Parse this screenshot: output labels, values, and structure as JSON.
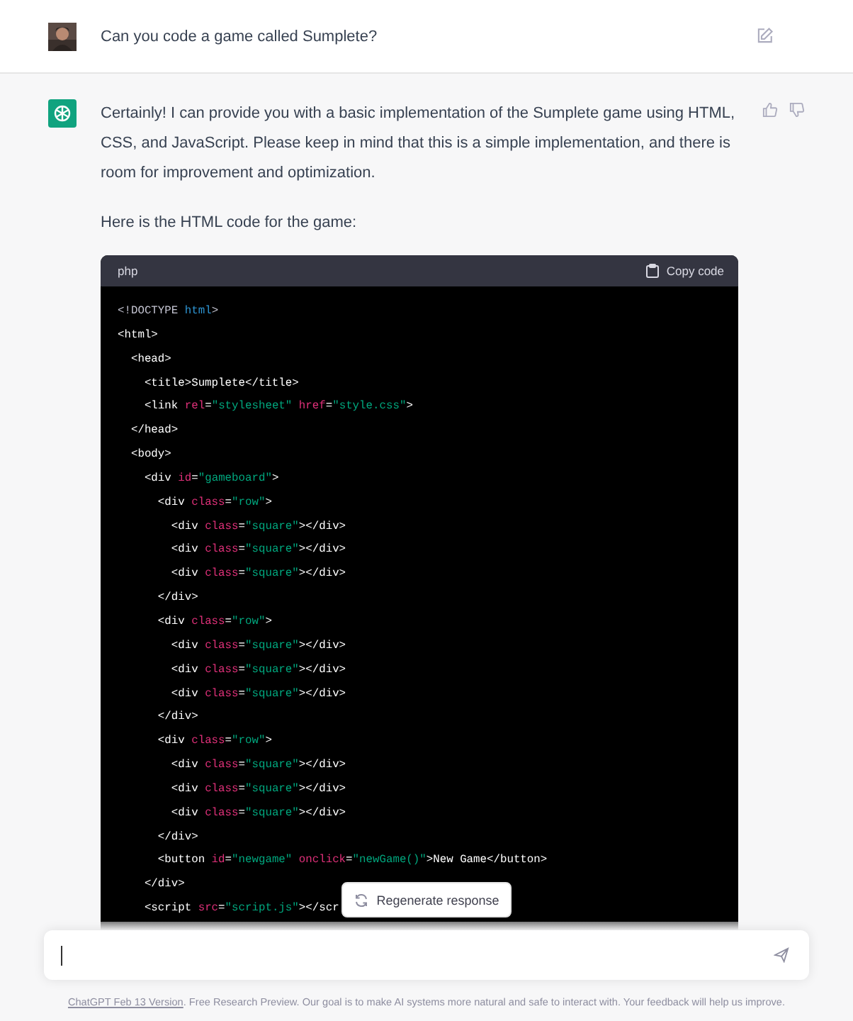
{
  "user_message": {
    "text": "Can you code a game called Sumplete?"
  },
  "assistant_message": {
    "paragraphs": [
      "Certainly! I can provide you with a basic implementation of the Sumplete game using HTML, CSS, and JavaScript. Please keep in mind that this is a simple implementation, and there is room for improvement and optimization.",
      "Here is the HTML code for the game:"
    ],
    "code_block": {
      "language": "php",
      "copy_label": "Copy code",
      "lines": [
        [
          {
            "kind": "punct",
            "text": "<!DOCTYPE "
          },
          {
            "kind": "keyword",
            "text": "html"
          },
          {
            "kind": "punct",
            "text": ">"
          }
        ],
        [
          {
            "kind": "tag",
            "text": "<html>"
          }
        ],
        [
          {
            "kind": "tag",
            "text": "  <head>"
          }
        ],
        [
          {
            "kind": "tag",
            "text": "    <title>Sumplete</title>"
          }
        ],
        [
          {
            "kind": "tag",
            "text": "    <link "
          },
          {
            "kind": "attr",
            "text": "rel"
          },
          {
            "kind": "tag",
            "text": "="
          },
          {
            "kind": "str",
            "text": "\"stylesheet\" "
          },
          {
            "kind": "attr",
            "text": "href"
          },
          {
            "kind": "tag",
            "text": "="
          },
          {
            "kind": "str",
            "text": "\"style.css\""
          },
          {
            "kind": "tag",
            "text": ">"
          }
        ],
        [
          {
            "kind": "tag",
            "text": "  </head>"
          }
        ],
        [
          {
            "kind": "tag",
            "text": "  <body>"
          }
        ],
        [
          {
            "kind": "tag",
            "text": "    <div "
          },
          {
            "kind": "attr",
            "text": "id"
          },
          {
            "kind": "tag",
            "text": "="
          },
          {
            "kind": "str",
            "text": "\"gameboard\""
          },
          {
            "kind": "tag",
            "text": ">"
          }
        ],
        [
          {
            "kind": "tag",
            "text": "      <div "
          },
          {
            "kind": "attr",
            "text": "class"
          },
          {
            "kind": "tag",
            "text": "="
          },
          {
            "kind": "str",
            "text": "\"row\""
          },
          {
            "kind": "tag",
            "text": ">"
          }
        ],
        [
          {
            "kind": "tag",
            "text": "        <div "
          },
          {
            "kind": "attr",
            "text": "class"
          },
          {
            "kind": "tag",
            "text": "="
          },
          {
            "kind": "str",
            "text": "\"square\""
          },
          {
            "kind": "tag",
            "text": "></div>"
          }
        ],
        [
          {
            "kind": "tag",
            "text": "        <div "
          },
          {
            "kind": "attr",
            "text": "class"
          },
          {
            "kind": "tag",
            "text": "="
          },
          {
            "kind": "str",
            "text": "\"square\""
          },
          {
            "kind": "tag",
            "text": "></div>"
          }
        ],
        [
          {
            "kind": "tag",
            "text": "        <div "
          },
          {
            "kind": "attr",
            "text": "class"
          },
          {
            "kind": "tag",
            "text": "="
          },
          {
            "kind": "str",
            "text": "\"square\""
          },
          {
            "kind": "tag",
            "text": "></div>"
          }
        ],
        [
          {
            "kind": "tag",
            "text": "      </div>"
          }
        ],
        [
          {
            "kind": "tag",
            "text": "      <div "
          },
          {
            "kind": "attr",
            "text": "class"
          },
          {
            "kind": "tag",
            "text": "="
          },
          {
            "kind": "str",
            "text": "\"row\""
          },
          {
            "kind": "tag",
            "text": ">"
          }
        ],
        [
          {
            "kind": "tag",
            "text": "        <div "
          },
          {
            "kind": "attr",
            "text": "class"
          },
          {
            "kind": "tag",
            "text": "="
          },
          {
            "kind": "str",
            "text": "\"square\""
          },
          {
            "kind": "tag",
            "text": "></div>"
          }
        ],
        [
          {
            "kind": "tag",
            "text": "        <div "
          },
          {
            "kind": "attr",
            "text": "class"
          },
          {
            "kind": "tag",
            "text": "="
          },
          {
            "kind": "str",
            "text": "\"square\""
          },
          {
            "kind": "tag",
            "text": "></div>"
          }
        ],
        [
          {
            "kind": "tag",
            "text": "        <div "
          },
          {
            "kind": "attr",
            "text": "class"
          },
          {
            "kind": "tag",
            "text": "="
          },
          {
            "kind": "str",
            "text": "\"square\""
          },
          {
            "kind": "tag",
            "text": "></div>"
          }
        ],
        [
          {
            "kind": "tag",
            "text": "      </div>"
          }
        ],
        [
          {
            "kind": "tag",
            "text": "      <div "
          },
          {
            "kind": "attr",
            "text": "class"
          },
          {
            "kind": "tag",
            "text": "="
          },
          {
            "kind": "str",
            "text": "\"row\""
          },
          {
            "kind": "tag",
            "text": ">"
          }
        ],
        [
          {
            "kind": "tag",
            "text": "        <div "
          },
          {
            "kind": "attr",
            "text": "class"
          },
          {
            "kind": "tag",
            "text": "="
          },
          {
            "kind": "str",
            "text": "\"square\""
          },
          {
            "kind": "tag",
            "text": "></div>"
          }
        ],
        [
          {
            "kind": "tag",
            "text": "        <div "
          },
          {
            "kind": "attr",
            "text": "class"
          },
          {
            "kind": "tag",
            "text": "="
          },
          {
            "kind": "str",
            "text": "\"square\""
          },
          {
            "kind": "tag",
            "text": "></div>"
          }
        ],
        [
          {
            "kind": "tag",
            "text": "        <div "
          },
          {
            "kind": "attr",
            "text": "class"
          },
          {
            "kind": "tag",
            "text": "="
          },
          {
            "kind": "str",
            "text": "\"square\""
          },
          {
            "kind": "tag",
            "text": "></div>"
          }
        ],
        [
          {
            "kind": "tag",
            "text": "      </div>"
          }
        ],
        [
          {
            "kind": "tag",
            "text": "      <button "
          },
          {
            "kind": "attr",
            "text": "id"
          },
          {
            "kind": "tag",
            "text": "="
          },
          {
            "kind": "str",
            "text": "\"newgame\" "
          },
          {
            "kind": "attr",
            "text": "onclick"
          },
          {
            "kind": "tag",
            "text": "="
          },
          {
            "kind": "str",
            "text": "\"newGame()\""
          },
          {
            "kind": "tag",
            "text": ">New Game</button>"
          }
        ],
        [
          {
            "kind": "tag",
            "text": "    </div>"
          }
        ],
        [
          {
            "kind": "tag",
            "text": "    <script "
          },
          {
            "kind": "attr",
            "text": "src"
          },
          {
            "kind": "tag",
            "text": "="
          },
          {
            "kind": "str",
            "text": "\"script.js\""
          },
          {
            "kind": "tag",
            "text": "></scr"
          }
        ]
      ]
    }
  },
  "regenerate_button": {
    "label": "Regenerate response"
  },
  "footer": {
    "link": "ChatGPT Feb 13 Version",
    "text": ". Free Research Preview. Our goal is to make AI systems more natural and safe to interact with. Your feedback will help us improve."
  }
}
